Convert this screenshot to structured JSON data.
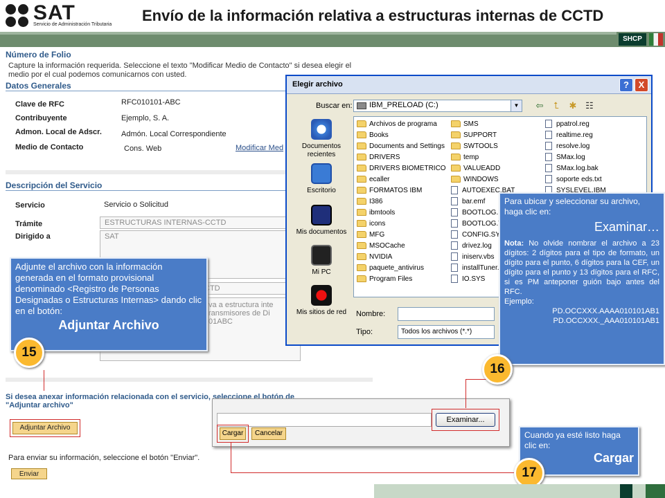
{
  "header": {
    "logo_text": "SAT",
    "logo_subtitle": "Servicio de Administración Tributaria",
    "title": "Envío de la información relativa a estructuras internas de CCTD",
    "badge": "SHCP"
  },
  "form": {
    "folio_heading": "Número de Folio",
    "folio_help": "Capture la información requerida. Seleccione el texto \"Modificar Medio de Contacto\" si desea elegir el medio por el cual podemos comunicarnos con usted.",
    "general_heading": "Datos Generales",
    "rfc_label": "Clave de RFC",
    "rfc_value": "RFC010101-ABC",
    "contrib_label": "Contribuyente",
    "contrib_value": "Ejemplo, S. A.",
    "admon_label": "Admon. Local de Adscr.",
    "admon_value": "Admón. Local Correspondiente",
    "contact_label": "Medio de Contacto",
    "contact_value": "Cons. Web",
    "contact_link": "Modificar Med",
    "service_heading": "Descripción del Servicio",
    "service_label": "Servicio",
    "service_value": "Servicio o Solicitud",
    "tramite_label": "Trámite",
    "tramite_value": "ESTRUCTURAS  INTERNAS-CCTD",
    "dirigido_label": "Dirigido a",
    "dirigido_value": "SAT",
    "field3_value": "CTD",
    "desc_line1": "va a estructura inte",
    "desc_line2": "ransmisores de Di",
    "desc_line3": "01ABC",
    "attach_text_line1": "Si desea anexar información relacionada con el servicio, seleccione el botón de",
    "attach_text_line2": "\"Adjuntar archivo\"",
    "attach_button": "Adjuntar Archivo",
    "send_text": "Para enviar su información, seleccione el botón \"Enviar\".",
    "send_button": "Enviar"
  },
  "dialog": {
    "title": "Elegir archivo",
    "help_btn": "?",
    "close_btn": "X",
    "lookin_label": "Buscar en:",
    "lookin_value": "IBM_PRELOAD (C:)",
    "places": [
      {
        "label": "Documentos recientes"
      },
      {
        "label": "Escritorio"
      },
      {
        "label": "Mis documentos"
      },
      {
        "label": "Mi PC"
      },
      {
        "label": "Mis sitios de red"
      }
    ],
    "col1": [
      "Archivos de programa",
      "Books",
      "Documents and Settings",
      "DRIVERS",
      "DRIVERS BIOMETRICO",
      "ecaller",
      "FORMATOS IBM",
      "I386",
      "ibmtools",
      "icons",
      "MFG",
      "MSOCache",
      "NVIDIA",
      "paquete_antivirus",
      "Program Files"
    ],
    "col2": [
      "SMS",
      "SUPPORT",
      "SWTOOLS",
      "temp",
      "VALUEADD",
      "WINDOWS",
      "AUTOEXEC.BAT",
      "bar.emf",
      "BOOTLOG.PR",
      "BOOTLOG.TX",
      "CONFIG.SYS",
      "drivez.log",
      "iniserv.vbs",
      "installTuner.",
      "IO.SYS"
    ],
    "col3": [
      "ppatrol.reg",
      "realtime.reg",
      "resolve.log",
      "SMax.log",
      "SMax.log.bak",
      "soporte eds.txt",
      "SYSLEVEL.IBM"
    ],
    "name_label": "Nombre:",
    "name_value": "",
    "type_label": "Tipo:",
    "type_value": "Todos los archivos (*.*)"
  },
  "upload": {
    "browse_button": "Examinar...",
    "load_button": "Cargar",
    "cancel_button": "Cancelar"
  },
  "callouts": {
    "c15": {
      "text": "Adjunte  el archivo con la información generada en  el formato provisional denominado <Registro de Personas Designadas o  Estructuras Internas> dando clic en el botón:",
      "big": "Adjuntar Archivo",
      "number": "15"
    },
    "c16": {
      "text": "Para ubicar y seleccionar su archivo, haga clic en:",
      "big": "Examinar…",
      "note_bold": "Nota:",
      "note": "No olvide nombrar el archivo  a 23 dígitos: 2 dígitos para el tipo de formato,  un dígito para el punto, 6 dígitos para la CEF, un dígito para el punto y 13 dígitos para el RFC, si es PM  anteponer guión bajo antes del RFC.",
      "example_label": "Ejemplo:",
      "example1": "PD.OCCXXX.AAAA010101AB1",
      "example2": "PD.OCCXXX._AAA010101AB1",
      "number": "16"
    },
    "c17": {
      "text": "Cuando ya esté listo haga clic en:",
      "big": "Cargar",
      "number": "17"
    }
  }
}
